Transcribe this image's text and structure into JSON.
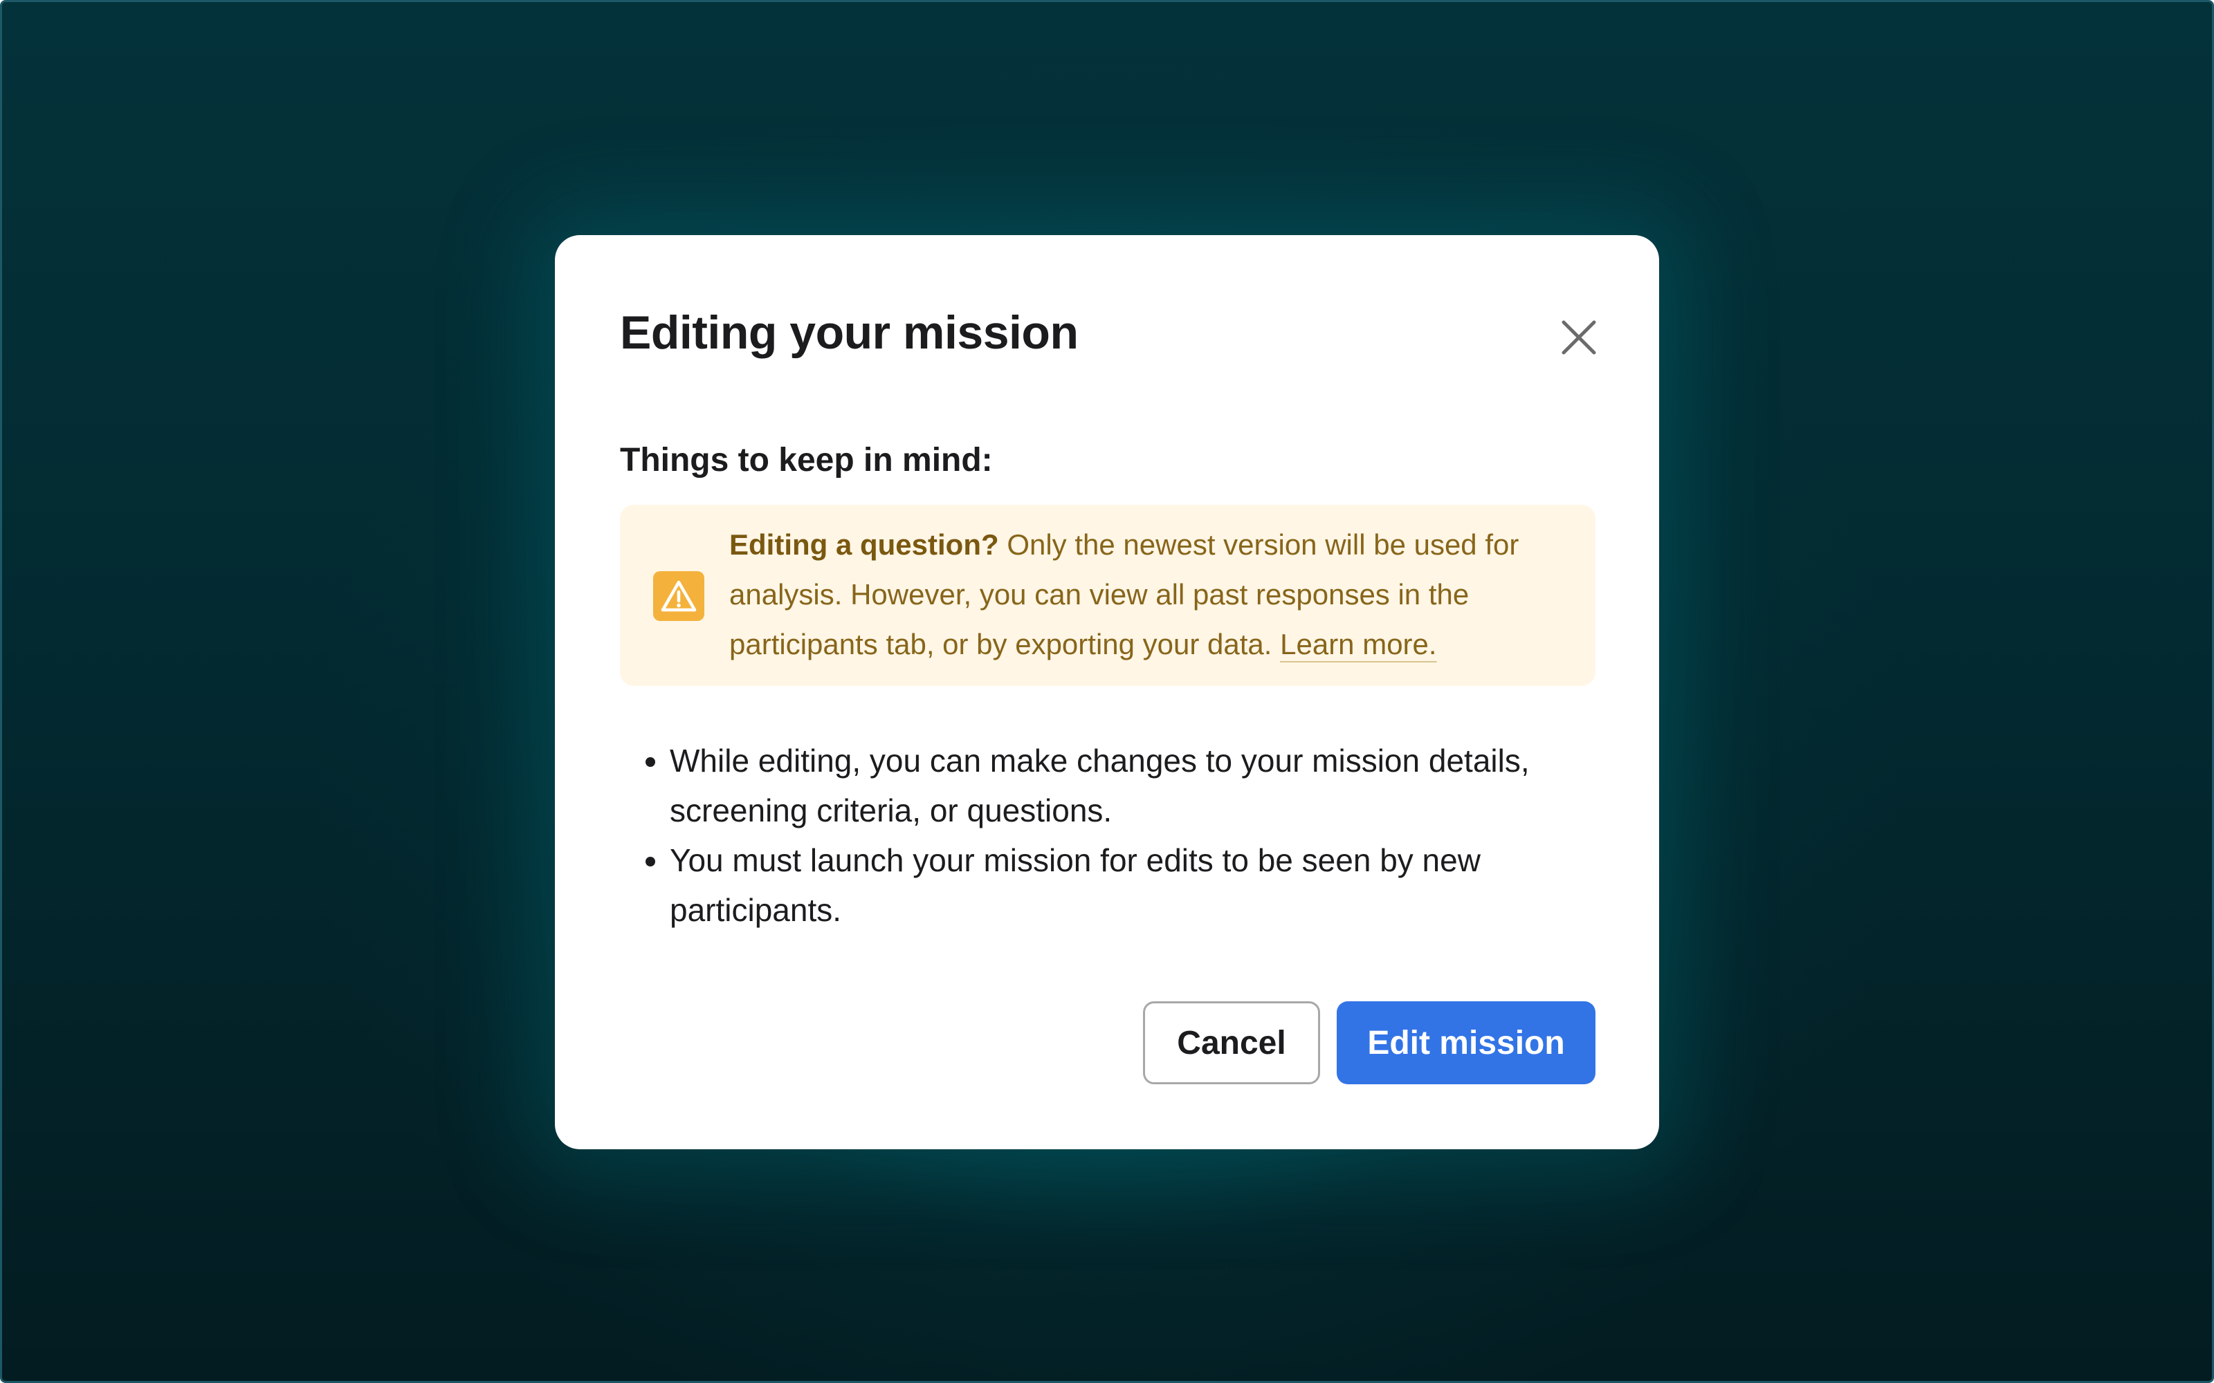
{
  "modal": {
    "title": "Editing your mission",
    "close_icon": "close-icon",
    "subheading": "Things to keep in mind:",
    "callout": {
      "icon": "warning-icon",
      "bold_text": "Editing a question?",
      "text": " Only the newest version will be used for analysis. However, you can view all past responses in the participants tab, or by exporting your data. ",
      "link_text": "Learn more.",
      "background_color": "#fff6e6",
      "text_color": "#87651a",
      "icon_color": "#f4b23c"
    },
    "bullets": [
      "While editing, you can make changes to your mission details, screening criteria, or questions.",
      "You must launch your mission for edits to be seen by new participants."
    ],
    "buttons": {
      "cancel_label": "Cancel",
      "primary_label": "Edit mission",
      "primary_color": "#3274e6"
    }
  }
}
